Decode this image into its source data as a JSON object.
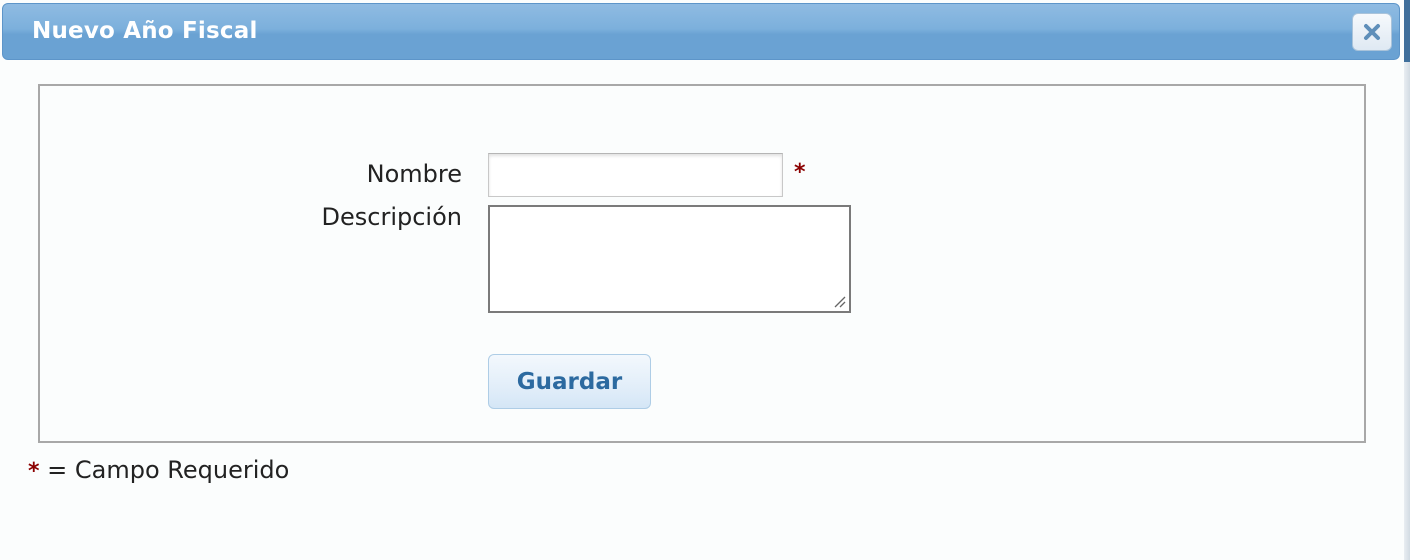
{
  "dialog": {
    "title": "Nuevo Año Fiscal",
    "close_icon": "close-icon"
  },
  "form": {
    "nombre": {
      "label": "Nombre",
      "value": "",
      "required_marker": "*"
    },
    "descripcion": {
      "label": "Descripción",
      "value": ""
    },
    "submit_label": "Guardar"
  },
  "legend": {
    "marker": "*",
    "text": "= Campo Requerido"
  },
  "colors": {
    "titlebar": "#6aa2d3",
    "required_star": "#8b0000",
    "button_text": "#2c6aa0"
  }
}
